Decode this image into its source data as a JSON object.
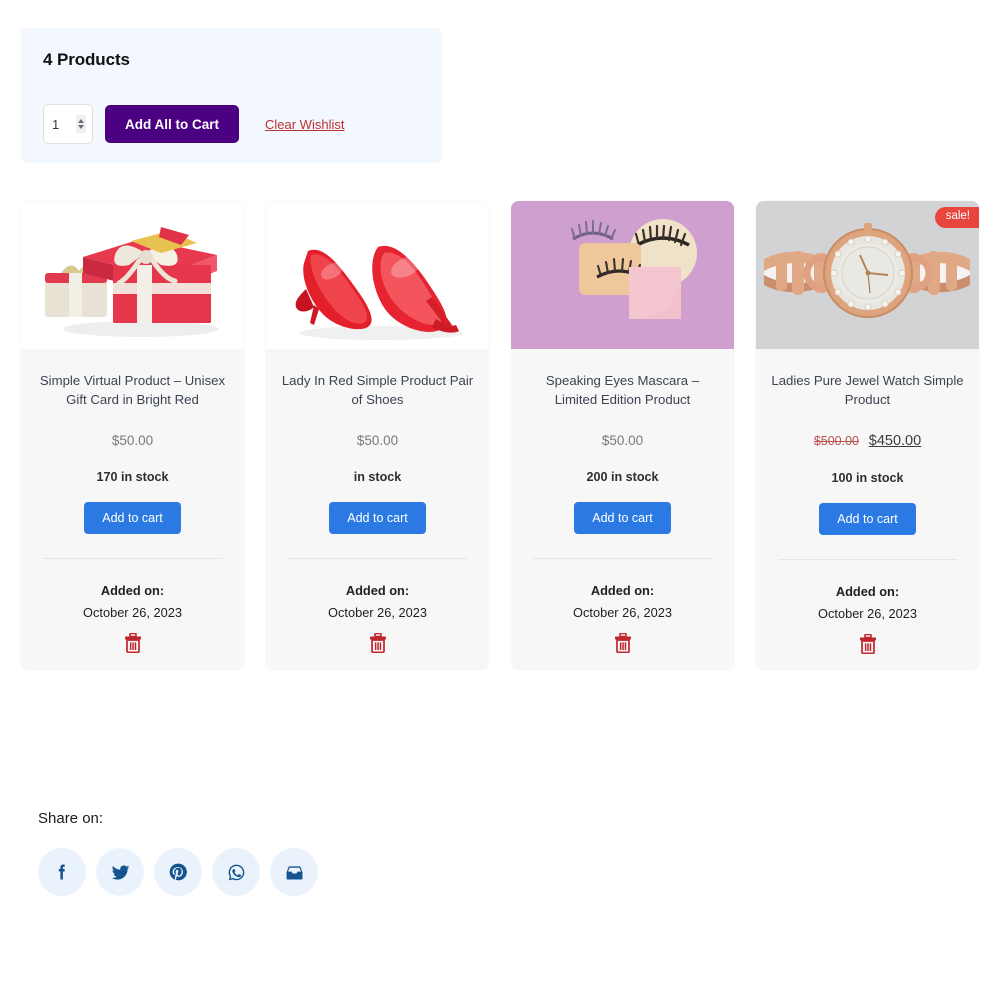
{
  "header": {
    "count_label": "4 Products",
    "quantity_value": "1",
    "quantity_placeholder": "1",
    "add_all_label": "Add All to Cart",
    "clear_label": "Clear Wishlist",
    "background_color": "#f2f8fd",
    "add_all_color": "#4b0082",
    "clear_link_color": "#bc3232"
  },
  "products": [
    {
      "title": "Simple Virtual Product – Unisex Gift Card in Bright Red",
      "price": "$50.00",
      "old_price": "",
      "sale_price": "",
      "stock": "170 in stock",
      "add_to_cart_label": "Add to cart",
      "added_label": "Added on:",
      "added_date": "October 26, 2023",
      "badge": "",
      "image_alt": "red-gift-boxes-image",
      "image_bg": "#ffffff"
    },
    {
      "title": "Lady In Red Simple Product Pair of Shoes",
      "price": "$50.00",
      "old_price": "",
      "sale_price": "",
      "stock": "in stock",
      "add_to_cart_label": "Add to cart",
      "added_label": "Added on:",
      "added_date": "October 26, 2023",
      "badge": "",
      "image_alt": "red-high-heel-shoes-image",
      "image_bg": "#ffffff"
    },
    {
      "title": "Speaking Eyes Mascara – Limited Edition Product",
      "price": "$50.00",
      "old_price": "",
      "sale_price": "",
      "stock": "200 in stock",
      "add_to_cart_label": "Add to cart",
      "added_label": "Added on:",
      "added_date": "October 26, 2023",
      "badge": "",
      "image_alt": "false-eyelashes-on-pink-image",
      "image_bg": "#cf9fd0"
    },
    {
      "title": "Ladies Pure Jewel Watch Simple Product",
      "price": "",
      "old_price": "$500.00",
      "sale_price": "$450.00",
      "stock": "100 in stock",
      "add_to_cart_label": "Add to cart",
      "added_label": "Added on:",
      "added_date": "October 26, 2023",
      "badge": "sale!",
      "image_alt": "rose-gold-ladies-watch-image",
      "image_bg": "#cfd0d2"
    }
  ],
  "share": {
    "label": "Share on:",
    "icons": [
      {
        "name": "facebook-icon"
      },
      {
        "name": "twitter-icon"
      },
      {
        "name": "pinterest-icon"
      },
      {
        "name": "whatsapp-icon"
      },
      {
        "name": "email-icon"
      }
    ],
    "circle_color": "#eaf3fb",
    "glyph_color": "#14558f"
  },
  "colors": {
    "add_to_cart": "#2b7ae4",
    "badge": "#e8453c",
    "trash": "#c0262b",
    "card_bg": "#f7f7f7"
  }
}
